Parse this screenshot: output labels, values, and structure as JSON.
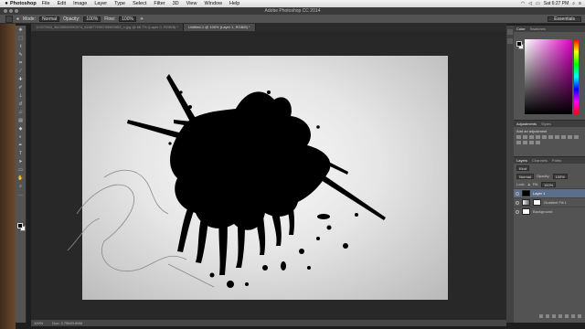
{
  "menubar": {
    "apple": "",
    "app_name": "Photoshop",
    "items": [
      "File",
      "Edit",
      "Image",
      "Layer",
      "Type",
      "Select",
      "Filter",
      "3D",
      "View",
      "Window",
      "Help"
    ],
    "clock": "Sat 6:27 PM"
  },
  "window": {
    "title": "Adobe Photoshop CC 2014"
  },
  "options": {
    "mode_label": "Mode:",
    "mode_value": "Normal",
    "opacity_label": "Opacity:",
    "opacity_value": "100%",
    "flow_label": "Flow:",
    "flow_value": "100%",
    "workspace": "Essentials"
  },
  "tabs": [
    {
      "label": "12327063_36028580090574_624677098755553553_n.jpg @ 66.7% (Layer 0, RGB/8) *"
    },
    {
      "label": "Untitled-1 @ 100% (Layer 1, RGB/8) *"
    }
  ],
  "status": {
    "zoom": "100%",
    "doc": "Doc: 2.75M/3.66M"
  },
  "panels": {
    "color_tab": "Color",
    "swatches_tab": "Swatches",
    "adjustments_tab": "Adjustments",
    "styles_tab": "Styles",
    "adjustments_title": "Add an adjustment",
    "layers_tab": "Layers",
    "channels_tab": "Channels",
    "paths_tab": "Paths",
    "kind_label": "Kind",
    "blend_mode": "Normal",
    "opacity_label": "Opacity:",
    "opacity_value": "100%",
    "lock_label": "Lock:",
    "fill_label": "Fill:",
    "fill_value": "100%"
  },
  "layers": [
    {
      "name": "Layer 1",
      "selected": true
    },
    {
      "name": "Gradient Fill 1",
      "selected": false
    },
    {
      "name": "Background",
      "selected": false
    }
  ],
  "colors": {
    "foreground": "#000000",
    "background": "#ffffff",
    "selection": "#5b6f8a"
  }
}
